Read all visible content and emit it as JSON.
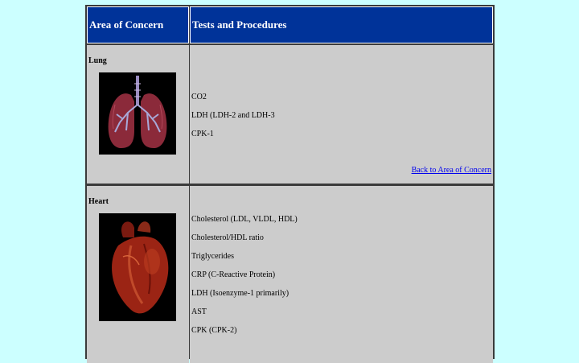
{
  "table": {
    "header": {
      "area_of_concern": "Area of Concern",
      "tests_and_procedures": "Tests and Procedures"
    },
    "rows": [
      {
        "organ": "Lung",
        "image": "lungs-illustration",
        "tests": [
          "CO2",
          "LDH (LDH-2 and LDH-3",
          "CPK-1"
        ],
        "back_link": "Back to Area of Concern"
      },
      {
        "organ": "Heart",
        "image": "heart-illustration",
        "tests": [
          "Cholesterol (LDL, VLDL, HDL)",
          "Cholesterol/HDL ratio",
          "Triglycerides",
          "CRP (C-Reactive Protein)",
          "LDH (Isoenzyme-1 primarily)",
          "AST",
          "CPK (CPK-2)"
        ]
      }
    ]
  },
  "colors": {
    "page_background": "#ccffff",
    "header_background": "#003399",
    "cell_background": "#cccccc",
    "link": "#0000ee"
  }
}
